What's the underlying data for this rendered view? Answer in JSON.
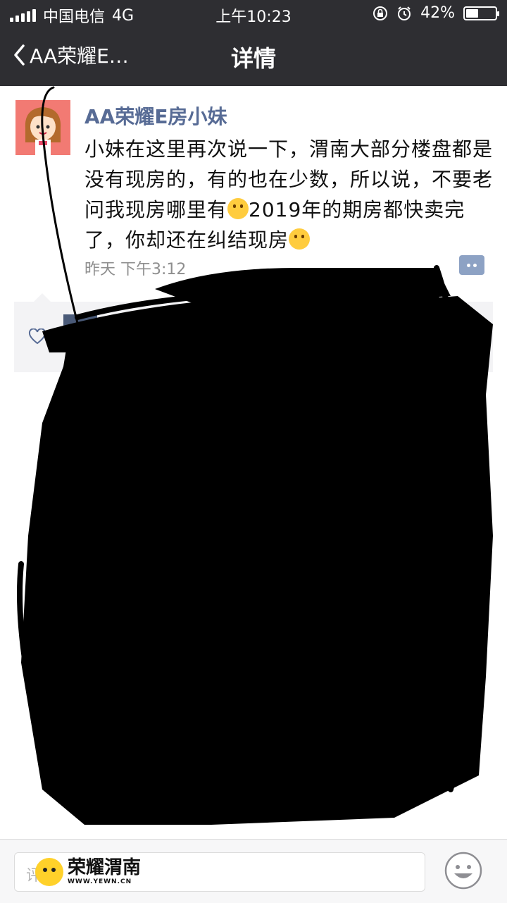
{
  "status_bar": {
    "carrier": "中国电信",
    "network": "4G",
    "time": "上午10:23",
    "battery_percent": "42%",
    "battery_level": 0.42
  },
  "nav": {
    "back_label": "AA荣耀E…",
    "title": "详情"
  },
  "post": {
    "author": "AA荣耀E房小妹",
    "text_part1": "小妹在这里再次说一下，渭南大部分楼盘都是没有现房的，有的也在少数，所以说，不要老问我现房哪里有",
    "text_part2": "2019年的期房都快卖完了，你却还在纠结现房",
    "emoji_1": "laugh-cry-emoji",
    "emoji_2": "smile-emoji",
    "timestamp": "昨天 下午3:12"
  },
  "input_bar": {
    "placeholder": "评论",
    "watermark_title": "荣耀渭南",
    "watermark_url": "WWW.YEWN.CN"
  },
  "colors": {
    "nav_bg": "#2e2e32",
    "author_color": "#576b95",
    "comment_btn": "#8da2c4"
  }
}
